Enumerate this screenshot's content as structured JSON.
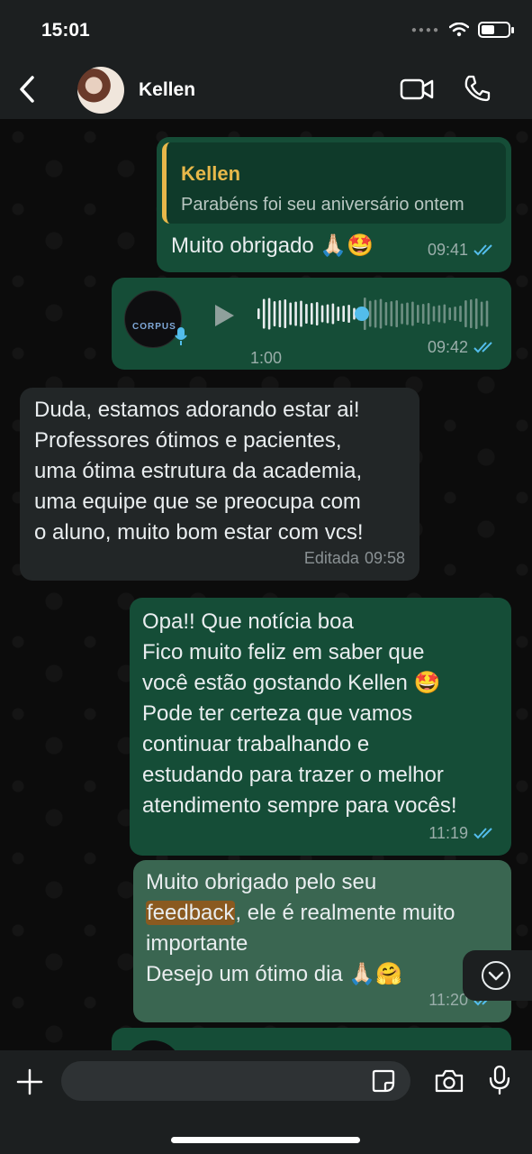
{
  "status_bar": {
    "time": "15:01"
  },
  "header": {
    "contact_name": "Kellen"
  },
  "messages": [
    {
      "quoted_author": "Kellen",
      "quoted_text": "Parabéns foi seu aniversário ontem",
      "text": "Muito obrigado 🙏🏻🤩",
      "time": "09:41"
    },
    {
      "voice_logo": "CORPUS",
      "duration": "1:00",
      "time": "09:42"
    },
    {
      "lines": [
        "Duda, estamos adorando estar ai!",
        "Professores ótimos e pacientes,",
        "uma ótima estrutura da academia,",
        "uma equipe que se preocupa com",
        "o aluno, muito bom estar com vcs!"
      ],
      "edited_label": "Editada",
      "time": "09:58"
    },
    {
      "lines": [
        "Opa!! Que notícia boa",
        "Fico muito feliz em saber que",
        "você estão gostando Kellen 🤩",
        "Pode ter certeza que vamos",
        "continuar trabalhando e",
        "estudando para trazer o melhor",
        "atendimento sempre para vocês!"
      ],
      "time": "11:19"
    },
    {
      "line1_prefix": "Muito obrigado pelo seu",
      "highlight": "feedback",
      "line2_suffix": ", ele é realmente muito",
      "line3": "importante",
      "line4": "Desejo um ótimo dia 🙏🏻🤗",
      "time": "11:20"
    }
  ],
  "composer": {
    "placeholder": ""
  },
  "icons": {
    "back": "chevron-left-icon",
    "video": "video-camera-icon",
    "phone": "phone-icon",
    "play": "play-icon",
    "plus": "plus-icon",
    "sticker": "sticker-icon",
    "camera": "camera-icon",
    "mic": "microphone-icon",
    "scroll": "chevron-down-icon"
  },
  "colors": {
    "outgoing_bubble": "#154d37",
    "incoming_bubble": "#222627",
    "quote_accent": "#e8b84a",
    "read_ticks": "#53bdeb"
  }
}
